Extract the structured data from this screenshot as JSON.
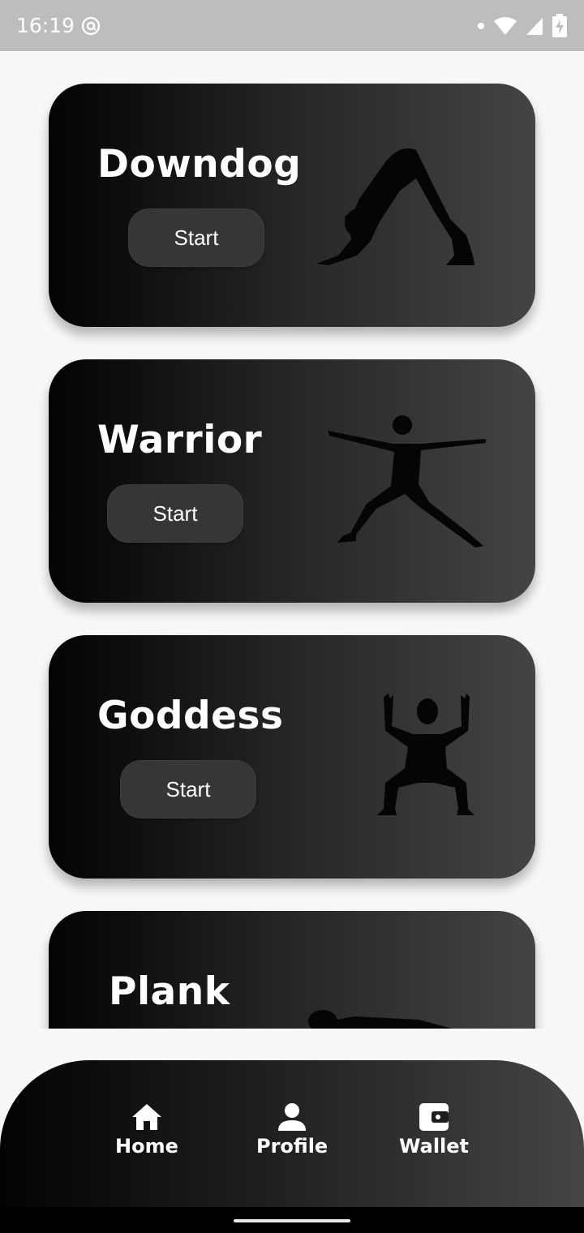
{
  "status_bar": {
    "time": "16:19",
    "icons": [
      "at-sign-icon",
      "dot-icon",
      "wifi-icon",
      "signal-icon",
      "battery-charging-icon"
    ]
  },
  "cards": [
    {
      "title": "Downdog",
      "button": "Start",
      "pose_icon": "downdog-silhouette"
    },
    {
      "title": "Warrior",
      "button": "Start",
      "pose_icon": "warrior-silhouette"
    },
    {
      "title": "Goddess",
      "button": "Start",
      "pose_icon": "goddess-silhouette"
    },
    {
      "title": "Plank",
      "pose_icon": "plank-silhouette"
    }
  ],
  "bottom_nav": [
    {
      "label": "Home",
      "icon": "home-icon"
    },
    {
      "label": "Profile",
      "icon": "person-icon"
    },
    {
      "label": "Wallet",
      "icon": "wallet-icon"
    }
  ],
  "colors": {
    "card_gradient_start": "#030303",
    "card_gradient_end": "#444444",
    "button_bg": "#363636",
    "page_bg": "#f8f8f8",
    "status_bar_bg": "#bdbdbd"
  }
}
